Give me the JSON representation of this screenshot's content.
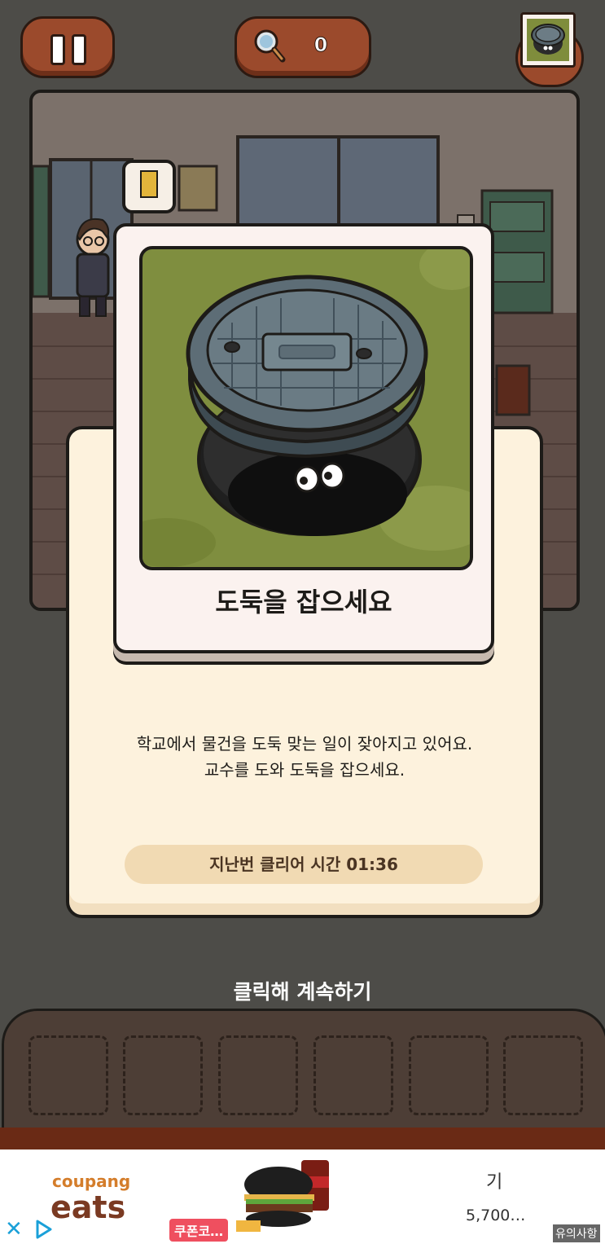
{
  "hud": {
    "hint_count": "0",
    "pause_icon": "pause-icon",
    "hint_icon": "magnifier-icon"
  },
  "intro_card": {
    "title": "도둑을 잡으세요",
    "description_lines": [
      "학교에서 물건을 도둑 맞는 일이 잦아지고 있어요.",
      "교수를 도와 도둑을 잡으세요."
    ],
    "clear_time_label": "지난번 클리어 시간 01:36"
  },
  "continue_label": "클릭해 계속하기",
  "inventory": {
    "slot_count": 6
  },
  "ad": {
    "brand_top": "coupang",
    "brand_bottom": "eats",
    "badge": "쿠폰코…",
    "title": "기",
    "price": "5,700…",
    "notice": "유의사항"
  },
  "colors": {
    "button_brown": "#9b4a2c",
    "panel_cream": "#fdf2dd",
    "pill": "#f1dab3",
    "card_grass": "#7f8e3f",
    "overlay": "#4d4c48"
  }
}
